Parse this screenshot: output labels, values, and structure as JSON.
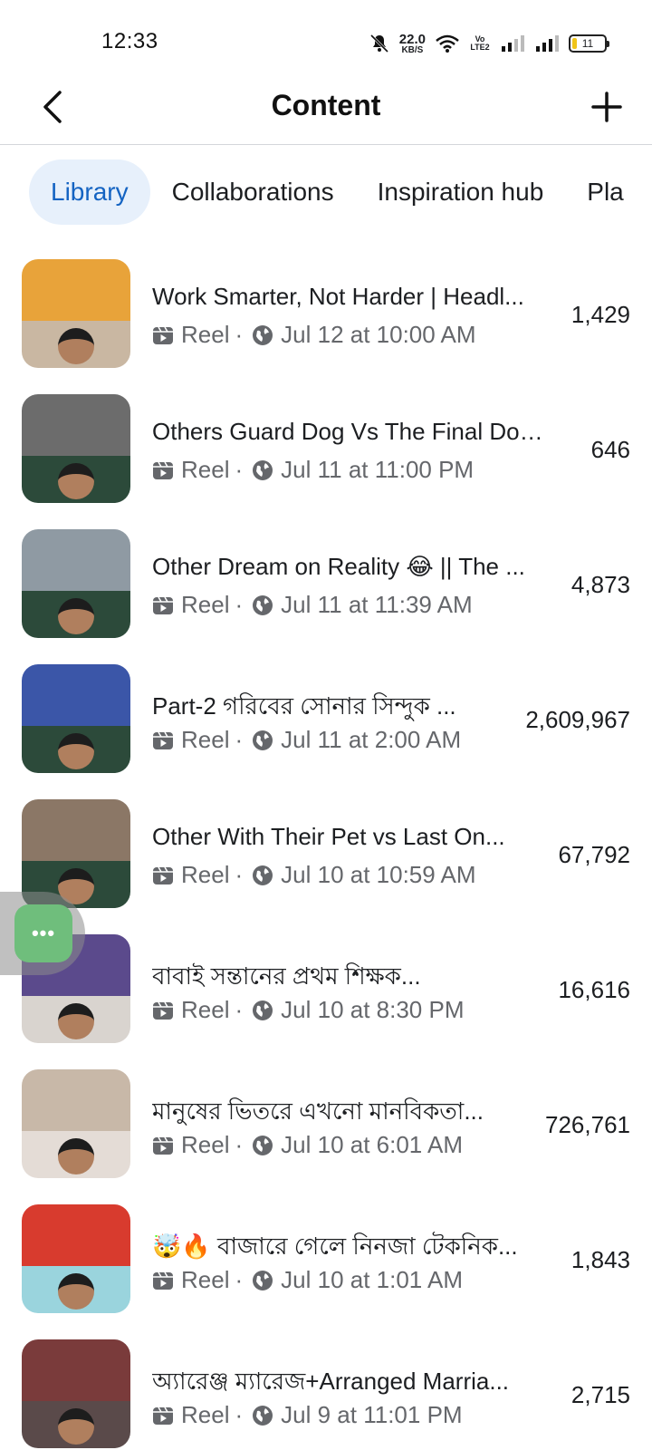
{
  "status_bar": {
    "time": "12:33",
    "net_speed": "22.0",
    "net_unit": "KB/S",
    "volte": "Vo LTE2",
    "battery": "11"
  },
  "header": {
    "title": "Content",
    "back_icon": "chevron-left-icon",
    "add_icon": "plus-icon"
  },
  "tabs": [
    {
      "label": "Library",
      "active": true
    },
    {
      "label": "Collaborations",
      "active": false
    },
    {
      "label": "Inspiration hub",
      "active": false
    },
    {
      "label": "Pla",
      "active": false
    }
  ],
  "items": [
    {
      "title": "Work Smarter, Not Harder | Headl...",
      "type": "Reel",
      "date": "Jul 12 at 10:00 AM",
      "count": "1,429"
    },
    {
      "title": "Others Guard Dog Vs The Final Dog...",
      "type": "Reel",
      "date": "Jul 11 at 11:00 PM",
      "count": "646"
    },
    {
      "title": "Other Dream on Reality 😂 || The ...",
      "type": "Reel",
      "date": "Jul 11 at 11:39 AM",
      "count": "4,873"
    },
    {
      "title": "Part-2 গরিবের সোনার সিন্দুক ...",
      "type": "Reel",
      "date": "Jul 11 at 2:00 AM",
      "count": "2,609,967"
    },
    {
      "title": "Other With Their Pet vs Last On...",
      "type": "Reel",
      "date": "Jul 10 at 10:59 AM",
      "count": "67,792"
    },
    {
      "title": "বাবাই সন্তানের প্রথম শিক্ষক...",
      "type": "Reel",
      "date": "Jul 10 at 8:30 PM",
      "count": "16,616"
    },
    {
      "title": "মানুষের ভিতরে এখনো মানবিকতা...",
      "type": "Reel",
      "date": "Jul 10 at 6:01 AM",
      "count": "726,761"
    },
    {
      "title": "🤯🔥 বাজারে গেলে নিনজা টেকনিক...",
      "type": "Reel",
      "date": "Jul 10 at 1:01 AM",
      "count": "1,843"
    },
    {
      "title": "অ্যারেঞ্জ ম্যারেজ+Arranged Marria...",
      "type": "Reel",
      "date": "Jul 9 at 11:01 PM",
      "count": "2,715"
    }
  ],
  "floating_button": {
    "label": "•••"
  },
  "colors": {
    "accent": "#1463c2",
    "active_tab_bg": "#e7f0fb",
    "meta_text": "#65676b",
    "floating_green": "#6fbe7c"
  }
}
